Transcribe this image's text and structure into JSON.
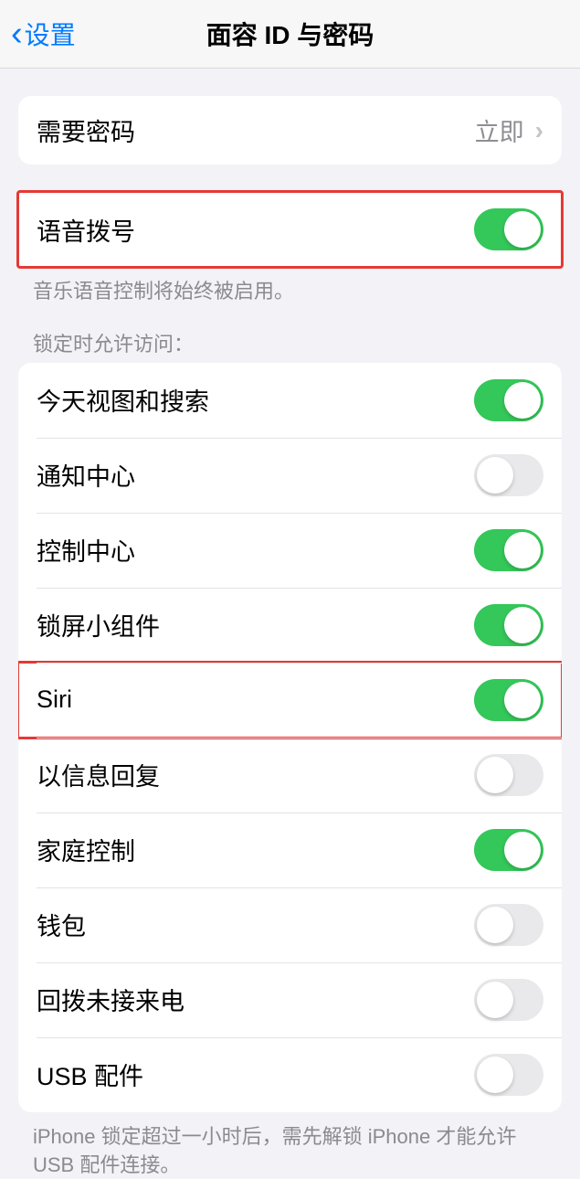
{
  "nav": {
    "back_label": "设置",
    "title": "面容 ID 与密码"
  },
  "passcode": {
    "label": "需要密码",
    "value": "立即"
  },
  "voice_dial": {
    "label": "语音拨号",
    "footer": "音乐语音控制将始终被启用。"
  },
  "locked_access": {
    "header": "锁定时允许访问：",
    "items": {
      "today": "今天视图和搜索",
      "notification": "通知中心",
      "control": "控制中心",
      "widgets": "锁屏小组件",
      "siri": "Siri",
      "reply": "以信息回复",
      "home": "家庭控制",
      "wallet": "钱包",
      "callback": "回拨未接来电",
      "usb": "USB 配件"
    },
    "footer": "iPhone 锁定超过一小时后，需先解锁 iPhone 才能允许USB 配件连接。"
  }
}
